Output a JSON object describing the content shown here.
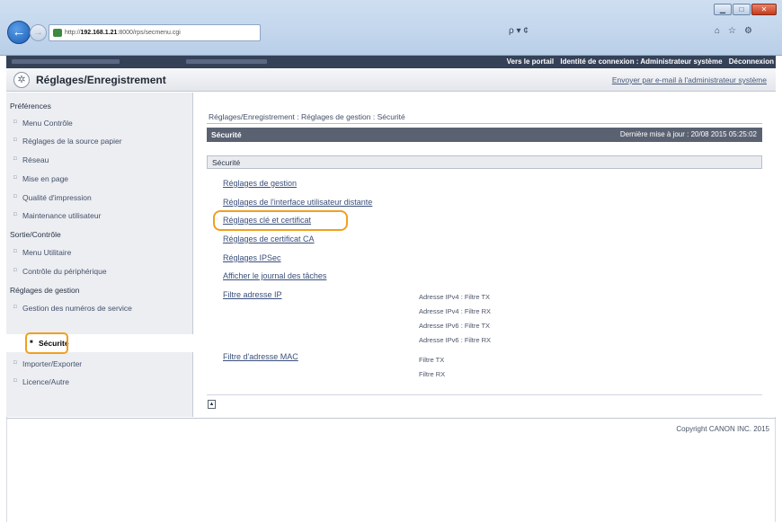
{
  "browser": {
    "url_prefix": "http://",
    "url_host": "192.168.1.21",
    "url_rest": ":8000/rps/secmenu.cgi",
    "search_symbol": "ρ ▾ ¢",
    "window_buttons": [
      "▁",
      "□",
      "✕"
    ],
    "nav_back": "←",
    "nav_forward": "→",
    "toolbar_icons": [
      "⌂",
      "☆",
      "⚙"
    ]
  },
  "topbar": {
    "portal_link": "Vers le portail",
    "identity_label": "Identité de connexion : Administrateur système",
    "logout_link": "Déconnexion"
  },
  "header": {
    "title": "Réglages/Enregistrement",
    "mail_link": "Envoyer par e-mail à l'administrateur système",
    "gear_symbol": "✲"
  },
  "sidebar": {
    "sections": [
      {
        "label": "Préférences",
        "items": [
          "Menu Contrôle",
          "Réglages de la source papier",
          "Réseau",
          "Mise en page",
          "Qualité d'impression",
          "Maintenance utilisateur"
        ]
      },
      {
        "label": "Sortie/Contrôle",
        "items": [
          "Menu Utilitaire",
          "Contrôle du périphérique"
        ]
      },
      {
        "label": "Réglages de gestion",
        "items": [
          "Gestion des numéros de service",
          "Sécurité",
          "Importer/Exporter",
          "Licence/Autre"
        ]
      }
    ],
    "active_item": "Sécurité"
  },
  "main": {
    "breadcrumb": "Réglages/Enregistrement : Réglages de gestion : Sécurité",
    "section_title": "Sécurité",
    "last_update": "Dernière mise à jour : 20/08 2015 05:25:02",
    "subsection_title": "Sécurité",
    "links": [
      "Réglages de gestion",
      "Réglages de l'interface utilisateur distante",
      "Réglages clé et certificat",
      "Réglages de certificat CA",
      "Réglages IPSec",
      "Afficher le journal des tâches",
      "Filtre adresse IP",
      "Filtre d'adresse MAC"
    ],
    "ip_filter_details": [
      "Adresse IPv4 : Filtre TX",
      "Adresse IPv4 : Filtre RX",
      "Adresse IPv6 : Filtre TX",
      "Adresse IPv6 : Filtre RX"
    ],
    "mac_filter_details": [
      "Filtre TX",
      "Filtre RX"
    ],
    "highlighted_link": "Réglages clé et certificat"
  },
  "footer": {
    "copyright": "Copyright CANON INC. 2015"
  }
}
